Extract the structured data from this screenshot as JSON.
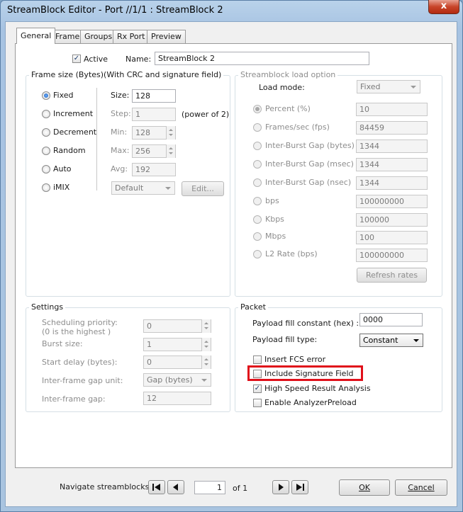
{
  "window": {
    "title": "StreamBlock Editor - Port //1/1 : StreamBlock 2",
    "close_glyph": "x"
  },
  "tabs": [
    {
      "label": "General",
      "active": true
    },
    {
      "label": "Frame"
    },
    {
      "label": "Groups"
    },
    {
      "label": "Rx Port"
    },
    {
      "label": "Preview"
    }
  ],
  "general": {
    "active_label": "Active",
    "active_checked": true,
    "name_label": "Name:",
    "name_value": "StreamBlock 2"
  },
  "frame_size": {
    "title": "Frame size (Bytes)(With CRC and signature field)",
    "modes": [
      "Fixed",
      "Increment",
      "Decrement",
      "Random",
      "Auto",
      "iMIX"
    ],
    "selected": "Fixed",
    "size_label": "Size:",
    "size_value": "128",
    "step_label": "Step:",
    "step_value": "1",
    "step_note": "(power of 2)",
    "min_label": "Min:",
    "min_value": "128",
    "max_label": "Max:",
    "max_value": "256",
    "avg_label": "Avg:",
    "avg_value": "192",
    "imix_value": "Default",
    "edit_label": "Edit..."
  },
  "load_option": {
    "title": "Streamblock load option",
    "load_mode_label": "Load mode:",
    "load_mode_value": "Fixed",
    "units": [
      {
        "label": "Percent (%)",
        "value": "10",
        "selected": true
      },
      {
        "label": "Frames/sec (fps)",
        "value": "84459"
      },
      {
        "label": "Inter-Burst Gap (bytes)",
        "value": "1344"
      },
      {
        "label": "Inter-Burst Gap (msec)",
        "value": "1344"
      },
      {
        "label": "Inter-Burst Gap (nsec)",
        "value": "1344"
      },
      {
        "label": "bps",
        "value": "100000000"
      },
      {
        "label": "Kbps",
        "value": "100000"
      },
      {
        "label": "Mbps",
        "value": "100"
      },
      {
        "label": "L2 Rate (bps)",
        "value": "100000000"
      }
    ],
    "refresh_label": "Refresh rates"
  },
  "settings": {
    "title": "Settings",
    "scheduling_label_1": "Scheduling priority:",
    "scheduling_label_2": "(0 is the highest )",
    "scheduling_value": "0",
    "burst_label": "Burst size:",
    "burst_value": "1",
    "start_delay_label": "Start delay (bytes):",
    "start_delay_value": "0",
    "gap_unit_label": "Inter-frame gap unit:",
    "gap_unit_value": "Gap (bytes)",
    "gap_label": "Inter-frame gap:",
    "gap_value": "12"
  },
  "packet": {
    "title": "Packet",
    "fill_constant_label": "Payload fill constant (hex) :",
    "fill_constant_value": "0000",
    "fill_type_label": "Payload fill type:",
    "fill_type_value": "Constant",
    "checks": [
      {
        "label": "Insert FCS error",
        "checked": false
      },
      {
        "label": "Include Signature Field",
        "checked": false,
        "highlighted": true
      },
      {
        "label": "High Speed Result Analysis",
        "checked": true
      },
      {
        "label": "Enable AnalyzerPreload",
        "checked": false
      }
    ]
  },
  "footer": {
    "navigate_label": "Navigate streamblocks:",
    "page_value": "1",
    "of_label": "of 1",
    "ok_label": "OK",
    "cancel_label": "Cancel"
  },
  "colors": {
    "highlight": "#e0101a",
    "accent": "#1a5bb5"
  }
}
